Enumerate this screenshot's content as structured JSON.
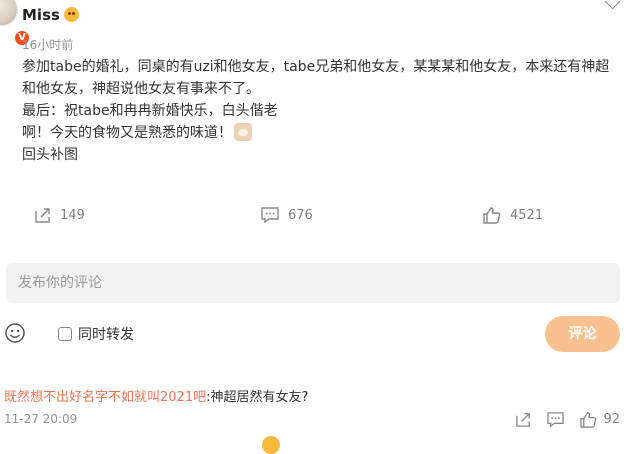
{
  "post": {
    "author": "Miss",
    "time": "16小时前",
    "paragraphs": [
      "参加tabe的婚礼，同桌的有uzi和他女友，tabe兄弟和他女友，某某某和他女友，本来还有神超和他女友，神超说他女友有事来不了。",
      "最后：祝tabe和冉冉新婚快乐，白头偕老",
      "啊！今天的食物又是熟悉的味道！",
      "回头补图"
    ],
    "shares": "149",
    "comments": "676",
    "likes": "4521"
  },
  "composer": {
    "placeholder": "发布你的评论",
    "repost_label": "同时转发",
    "submit_label": "评论"
  },
  "reply": {
    "user": "既然想不出好名字不如就叫2021吧",
    "text": ":神超居然有女友?",
    "time": "11-27 20:09",
    "likes": "92"
  },
  "colors": {
    "accent": "#eb7350",
    "submit_bg": "#f9c08f",
    "verified": "#f44f1f"
  },
  "icons": [
    "emoji-face-icon",
    "verified-icon",
    "chevron-down-icon",
    "share-icon",
    "comment-icon",
    "like-icon",
    "smile-icon"
  ]
}
